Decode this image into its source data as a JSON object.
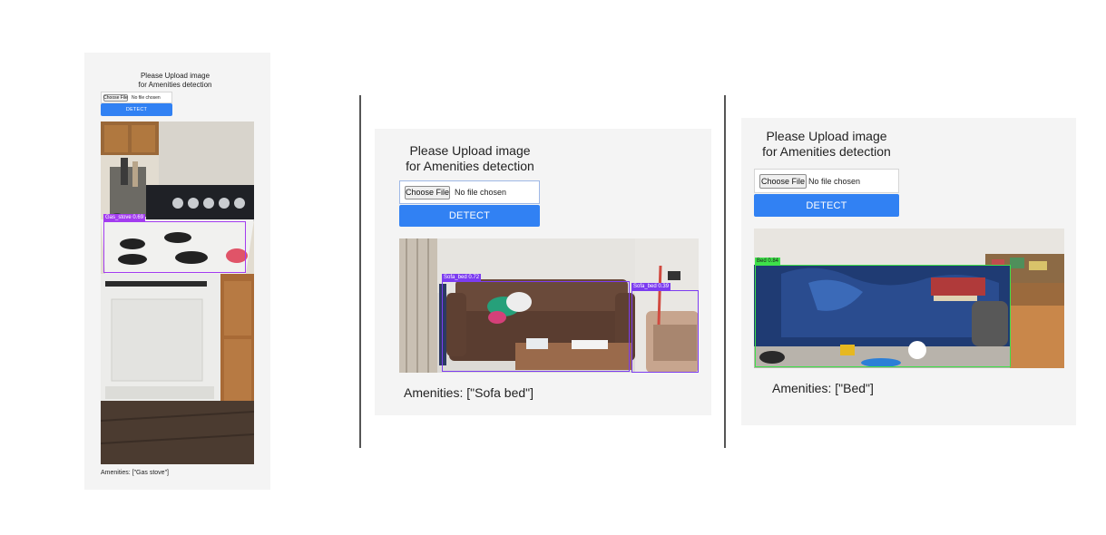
{
  "panels": [
    {
      "title_line1": "Please Upload image",
      "title_line2": "for Amenities detection",
      "choose_file_label": "Choose File",
      "no_file_text": "No file chosen",
      "detect_label": "DETECT",
      "amenities_text": "Amenities: [\"Gas stove\"]",
      "detections": [
        {
          "label": "Gas_stove 0.69",
          "color": "#a33cf0"
        }
      ]
    },
    {
      "title_line1": "Please Upload image",
      "title_line2": "for Amenities detection",
      "choose_file_label": "Choose File",
      "no_file_text": "No file chosen",
      "detect_label": "DETECT",
      "amenities_text": "Amenities: [\"Sofa bed\"]",
      "detections": [
        {
          "label": "Sofa_bed 0.72",
          "color": "#7c3cf0"
        },
        {
          "label": "Sofa_bed 0.39",
          "color": "#7c3cf0"
        }
      ]
    },
    {
      "title_line1": "Please Upload image",
      "title_line2": "for Amenities detection",
      "choose_file_label": "Choose File",
      "no_file_text": "No file chosen",
      "detect_label": "DETECT",
      "amenities_text": "Amenities: [\"Bed\"]",
      "detections": [
        {
          "label": "Bed 0.84",
          "color": "#3ee04a"
        }
      ]
    }
  ],
  "colors": {
    "detect_button": "#3181f3",
    "panel_bg": "#f4f4f4",
    "divider": "#555555"
  }
}
